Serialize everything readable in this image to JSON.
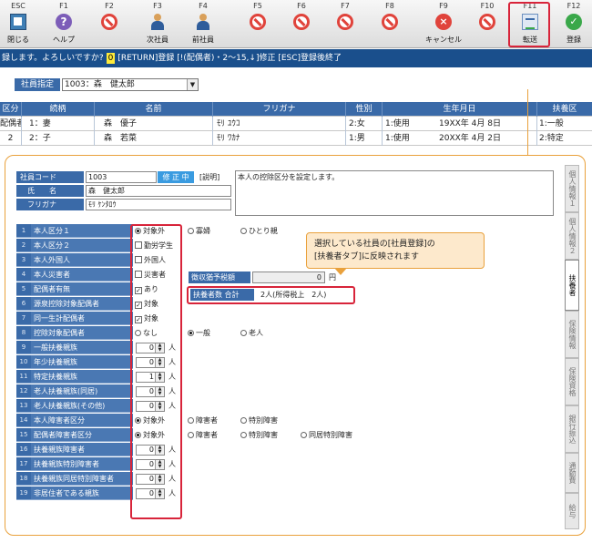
{
  "toolbar": {
    "keys": [
      {
        "code": "ESC",
        "label": "閉じる",
        "icon": "close-window-icon"
      },
      {
        "code": "F1",
        "label": "ヘルプ",
        "icon": "help-icon"
      },
      {
        "code": "F2",
        "label": "",
        "icon": "disabled-icon"
      },
      {
        "code": "F3",
        "label": "次社員",
        "icon": "next-employee-icon"
      },
      {
        "code": "F4",
        "label": "前社員",
        "icon": "previous-employee-icon"
      },
      {
        "code": "F5",
        "label": "",
        "icon": "disabled-icon"
      },
      {
        "code": "F6",
        "label": "",
        "icon": "disabled-icon"
      },
      {
        "code": "F7",
        "label": "",
        "icon": "disabled-icon"
      },
      {
        "code": "F8",
        "label": "",
        "icon": "disabled-icon"
      },
      {
        "code": "F9",
        "label": "キャンセル",
        "icon": "cancel-icon"
      },
      {
        "code": "F10",
        "label": "",
        "icon": "disabled-icon"
      },
      {
        "code": "F11",
        "label": "転送",
        "icon": "transfer-icon"
      },
      {
        "code": "F12",
        "label": "登録",
        "icon": "register-icon"
      }
    ]
  },
  "prompt": {
    "pre": "録します。よろしいですか?",
    "value": "0",
    "post": "[RETURN]登録 [!(配偶者)・2〜15,↓]修正 [ESC]登録後終了"
  },
  "employee": {
    "label": "社員指定",
    "selected": "1003：森　健太郎"
  },
  "dependents": {
    "headers": [
      "区分",
      "続柄",
      "名前",
      "フリガナ",
      "性別",
      "生年月日",
      "扶養区"
    ],
    "rows": [
      [
        "配偶者",
        "1：妻",
        "森　優子",
        "ﾓﾘ ﾕｳｺ",
        "2:女",
        "1:使用",
        "19XX年 4月 8日",
        "1:一般"
      ],
      [
        "2",
        "2：子",
        "森　若菜",
        "ﾓﾘ ﾜｶﾅ",
        "1:男",
        "1:使用",
        "20XX年 4月 2日",
        "2:特定"
      ]
    ]
  },
  "detail": {
    "code_label": "社員コード",
    "code_value": "1003",
    "editing": "修 正 中",
    "desc_label": "[説明]",
    "desc_text": "本人の控除区分を設定します。",
    "name_label": "氏　　名",
    "name_value": "森　健太郎",
    "kana_label": "フリガナ",
    "kana_value": "ﾓﾘ ｹﾝﾀﾛｳ",
    "tax_label": "徴収猶予税額",
    "tax_value": "0",
    "tax_unit": "円",
    "total_label": "扶養者数 合計",
    "total_value": "2人(所得税上　2人)",
    "attributes": [
      {
        "num": "1",
        "label": "本人区分１"
      },
      {
        "num": "2",
        "label": "本人区分２"
      },
      {
        "num": "3",
        "label": "本人外国人"
      },
      {
        "num": "4",
        "label": "本人災害者"
      },
      {
        "num": "5",
        "label": "配偶者有無"
      },
      {
        "num": "6",
        "label": "源泉控除対象配偶者"
      },
      {
        "num": "7",
        "label": "同一生計配偶者"
      },
      {
        "num": "8",
        "label": "控除対象配偶者"
      },
      {
        "num": "9",
        "label": "一般扶養親族"
      },
      {
        "num": "10",
        "label": "年少扶養親族"
      },
      {
        "num": "11",
        "label": "特定扶養親族"
      },
      {
        "num": "12",
        "label": "老人扶養親族(同居)"
      },
      {
        "num": "13",
        "label": "老人扶養親族(その他)"
      },
      {
        "num": "14",
        "label": "本人障害者区分"
      },
      {
        "num": "15",
        "label": "配偶者障害者区分"
      },
      {
        "num": "16",
        "label": "扶養親族障害者"
      },
      {
        "num": "17",
        "label": "扶養親族特別障害者"
      },
      {
        "num": "18",
        "label": "扶養親族同居特別障害者"
      },
      {
        "num": "19",
        "label": "非居住者である親族"
      }
    ],
    "options": {
      "r1": [
        "対象外",
        "寡婦",
        "ひとり親"
      ],
      "r2": "勤労学生",
      "r3": "外国人",
      "r4": "災害者",
      "r5": "あり",
      "r6": "対象",
      "r7": "対象",
      "r8": [
        "なし",
        "一般",
        "老人"
      ],
      "r14": [
        "対象外",
        "障害者",
        "特別障害"
      ],
      "r15": [
        "対象外",
        "障害者",
        "特別障害",
        "同居特別障害"
      ],
      "counts": [
        "0",
        "0",
        "1",
        "0",
        "0",
        "0",
        "0",
        "0",
        "0"
      ],
      "count_unit": "人"
    }
  },
  "callout": {
    "line1": "選択している社員の[社員登録]の",
    "line2": "[扶養者タブ]に反映されます"
  },
  "side_tabs": [
    "個人情報１",
    "個人情報２",
    "扶養者",
    "保険情報",
    "保険資格",
    "銀行振込",
    "通勤費",
    "給与"
  ],
  "colors": {
    "accent": "#3a6aa8",
    "highlight": "#d8243a",
    "callout": "#fde9cc"
  }
}
